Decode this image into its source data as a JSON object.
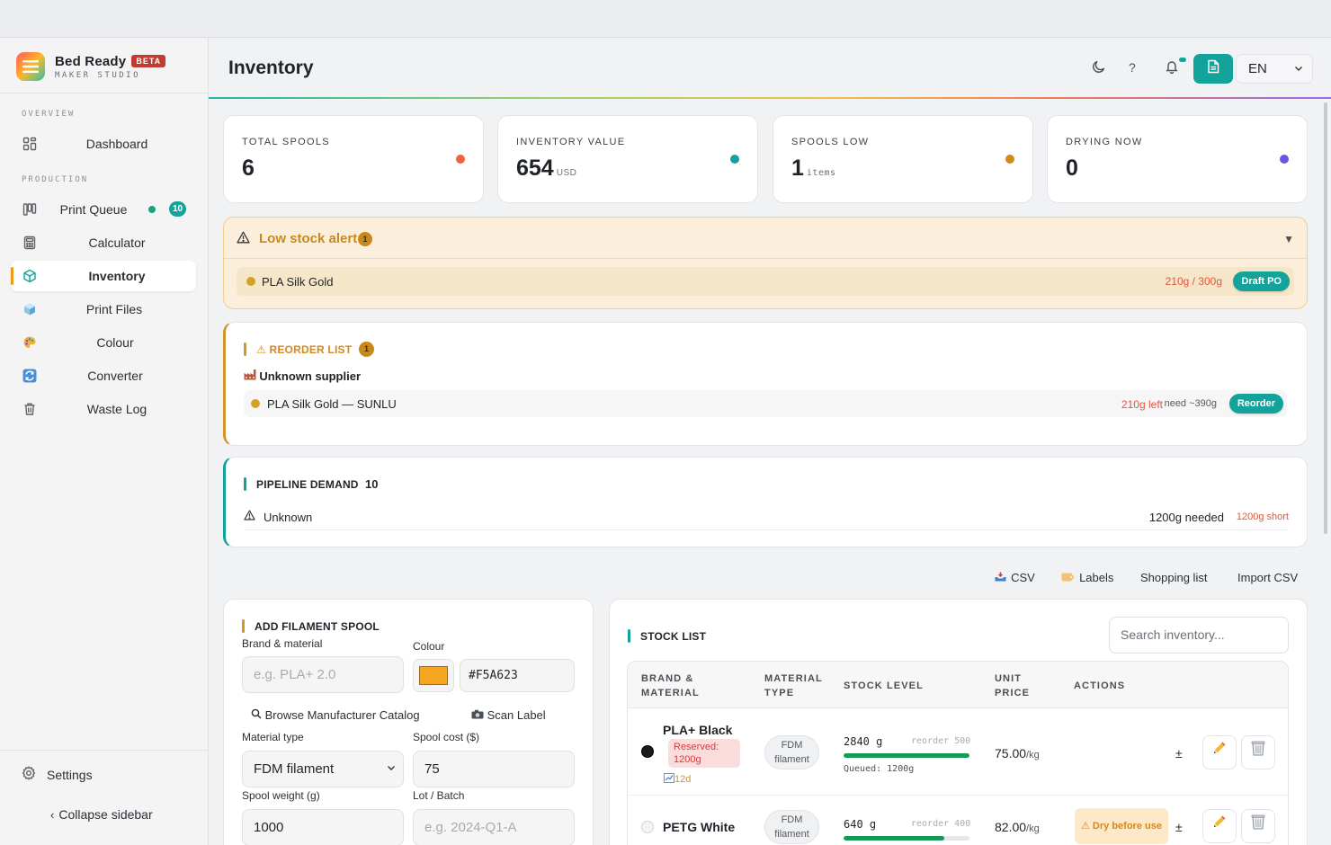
{
  "app": {
    "name": "Bed Ready",
    "badge": "BETA",
    "subtitle": "MAKER STUDIO"
  },
  "sidebar": {
    "sections": [
      {
        "label": "OVERVIEW"
      },
      {
        "label": "PRODUCTION"
      }
    ],
    "items": [
      {
        "label": "Dashboard",
        "icon": "dashboard-grid-icon"
      },
      {
        "label": "Print Queue",
        "icon": "print-queue-icon",
        "badge": "10"
      },
      {
        "label": "Calculator",
        "icon": "calculator-icon"
      },
      {
        "label": "Inventory",
        "icon": "cube-icon",
        "active": true
      },
      {
        "label": "Print Files",
        "icon": "print-files-icon"
      },
      {
        "label": "Colour",
        "icon": "palette-icon"
      },
      {
        "label": "Converter",
        "icon": "converter-icon"
      },
      {
        "label": "Waste Log",
        "icon": "trash-icon"
      }
    ],
    "settings_label": "Settings",
    "collapse_label": "Collapse sidebar",
    "collapse_chevron": "‹"
  },
  "header": {
    "title": "Inventory",
    "help": "?",
    "language": "EN"
  },
  "stats": [
    {
      "label": "TOTAL SPOOLS",
      "value": "6",
      "unit": "",
      "color": "#f0623a"
    },
    {
      "label": "INVENTORY VALUE",
      "value": "654",
      "unit": "USD",
      "color": "#14a39a"
    },
    {
      "label": "SPOOLS LOW",
      "value": "1",
      "unit": "items",
      "color": "#d08a1a"
    },
    {
      "label": "DRYING NOW",
      "value": "0",
      "unit": "",
      "color": "#6b54e0"
    }
  ],
  "low_stock": {
    "title": "Low stock alert",
    "count": "1",
    "toggle": "▼",
    "item": {
      "name": "PLA Silk Gold",
      "qty": "210g / 300g",
      "action": "Draft PO"
    }
  },
  "reorder": {
    "title": "⚠ REORDER LIST",
    "count": "1",
    "supplier": "Unknown supplier",
    "item": {
      "name": "PLA Silk Gold — SUNLU",
      "left": "210g left",
      "need": "need ~390g",
      "action": "Reorder"
    }
  },
  "pipeline": {
    "title": "PIPELINE DEMAND",
    "count": "10",
    "item": {
      "name": "Unknown",
      "needed": "1200g needed",
      "short": "1200g short"
    }
  },
  "toolbar": {
    "csv": "CSV",
    "labels": "Labels",
    "shopping": "Shopping list",
    "import": "Import CSV"
  },
  "add_form": {
    "title": "ADD FILAMENT SPOOL",
    "brand_label": "Brand & material",
    "brand_placeholder": "e.g. PLA+ 2.0",
    "colour_label": "Colour",
    "colour_hex": "#F5A623",
    "catalog_link": "Browse Manufacturer Catalog",
    "scan_link": "Scan Label",
    "material_label": "Material type",
    "material_value": "FDM filament",
    "cost_label": "Spool cost ($)",
    "cost_value": "75",
    "weight_label": "Spool weight (g)",
    "weight_value": "1000",
    "lot_label": "Lot / Batch",
    "lot_placeholder": "e.g. 2024-Q1-A"
  },
  "stock_list": {
    "title": "STOCK LIST",
    "search_placeholder": "Search inventory...",
    "columns": [
      "BRAND & MATERIAL",
      "MATERIAL TYPE",
      "STOCK LEVEL",
      "UNIT PRICE",
      "ACTIONS"
    ],
    "rows": [
      {
        "name": "PLA+ Black",
        "colour": "#1a1a1a",
        "reserved": "Reserved: 1200g",
        "age": "12d",
        "material": "FDM filament",
        "stock": "2840 g",
        "reorder": "reorder 500",
        "queued": "Queued: 1200g",
        "fill_pct": 100,
        "price": "75.00",
        "price_unit": "/kg",
        "adjust": "±"
      },
      {
        "name": "PETG White",
        "colour": "#f4f4f4",
        "material": "FDM filament",
        "stock": "640 g",
        "reorder": "reorder 400",
        "fill_pct": 80,
        "price": "82.00",
        "price_unit": "/kg",
        "badge": "⚠ Dry before use",
        "adjust": "±"
      }
    ]
  }
}
